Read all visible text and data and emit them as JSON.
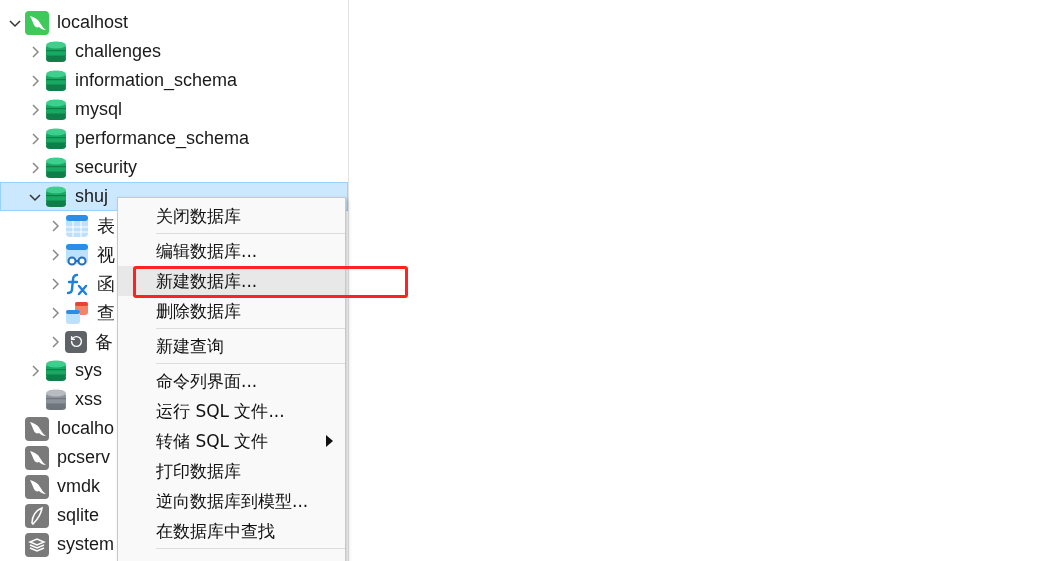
{
  "tree": [
    {
      "label": "localhost",
      "kind": "mysql",
      "open": true,
      "expanded": true,
      "selected": false,
      "children": [
        {
          "label": "challenges",
          "kind": "database",
          "open": true,
          "expanded": false,
          "selected": false
        },
        {
          "label": "information_schema",
          "kind": "database",
          "open": true,
          "expanded": false,
          "selected": false
        },
        {
          "label": "mysql",
          "kind": "database",
          "open": true,
          "expanded": false,
          "selected": false
        },
        {
          "label": "performance_schema",
          "kind": "database",
          "open": true,
          "expanded": false,
          "selected": false
        },
        {
          "label": "security",
          "kind": "database",
          "open": true,
          "expanded": false,
          "selected": false
        },
        {
          "label": "shuj",
          "kind": "database",
          "open": true,
          "expanded": true,
          "selected": true,
          "children": [
            {
              "label": "表",
              "kind": "tables",
              "open": true,
              "expanded": false,
              "selected": false
            },
            {
              "label": "视",
              "kind": "views",
              "open": true,
              "expanded": false,
              "selected": false
            },
            {
              "label": "函",
              "kind": "functions",
              "open": true,
              "expanded": false,
              "selected": false
            },
            {
              "label": "查",
              "kind": "queries",
              "open": true,
              "expanded": false,
              "selected": false
            },
            {
              "label": "备",
              "kind": "backups",
              "open": true,
              "expanded": false,
              "selected": false
            }
          ]
        },
        {
          "label": "sys",
          "kind": "database",
          "open": true,
          "expanded": false,
          "selected": false
        },
        {
          "label": "xss",
          "kind": "database",
          "open": false,
          "selected": false
        }
      ]
    },
    {
      "label": "localho",
      "kind": "mysql",
      "open": false,
      "selected": false
    },
    {
      "label": "pcserv",
      "kind": "mysql",
      "open": false,
      "selected": false
    },
    {
      "label": "vmdk",
      "kind": "mysql",
      "open": false,
      "selected": false
    },
    {
      "label": "sqlite",
      "kind": "sqlite",
      "open": false,
      "selected": false
    },
    {
      "label": "system",
      "kind": "redis",
      "open": false,
      "selected": false
    }
  ],
  "context_menu": {
    "items": [
      {
        "kind": "item",
        "label": "关闭数据库",
        "hovered": false,
        "submenu": false
      },
      {
        "kind": "separator"
      },
      {
        "kind": "item",
        "label": "编辑数据库...",
        "hovered": false,
        "submenu": false
      },
      {
        "kind": "item",
        "label": "新建数据库...",
        "hovered": true,
        "submenu": false
      },
      {
        "kind": "item",
        "label": "删除数据库",
        "hovered": false,
        "submenu": false
      },
      {
        "kind": "separator"
      },
      {
        "kind": "item",
        "label": "新建查询",
        "hovered": false,
        "submenu": false
      },
      {
        "kind": "separator"
      },
      {
        "kind": "item",
        "label": "命令列界面...",
        "hovered": false,
        "submenu": false
      },
      {
        "kind": "item",
        "label": "运行 SQL 文件...",
        "hovered": false,
        "submenu": false
      },
      {
        "kind": "item",
        "label": "转储 SQL 文件",
        "hovered": false,
        "submenu": true
      },
      {
        "kind": "item",
        "label": "打印数据库",
        "hovered": false,
        "submenu": false
      },
      {
        "kind": "item",
        "label": "逆向数据库到模型...",
        "hovered": false,
        "submenu": false
      },
      {
        "kind": "item",
        "label": "在数据库中查找",
        "hovered": false,
        "submenu": false
      },
      {
        "kind": "separator"
      }
    ]
  }
}
